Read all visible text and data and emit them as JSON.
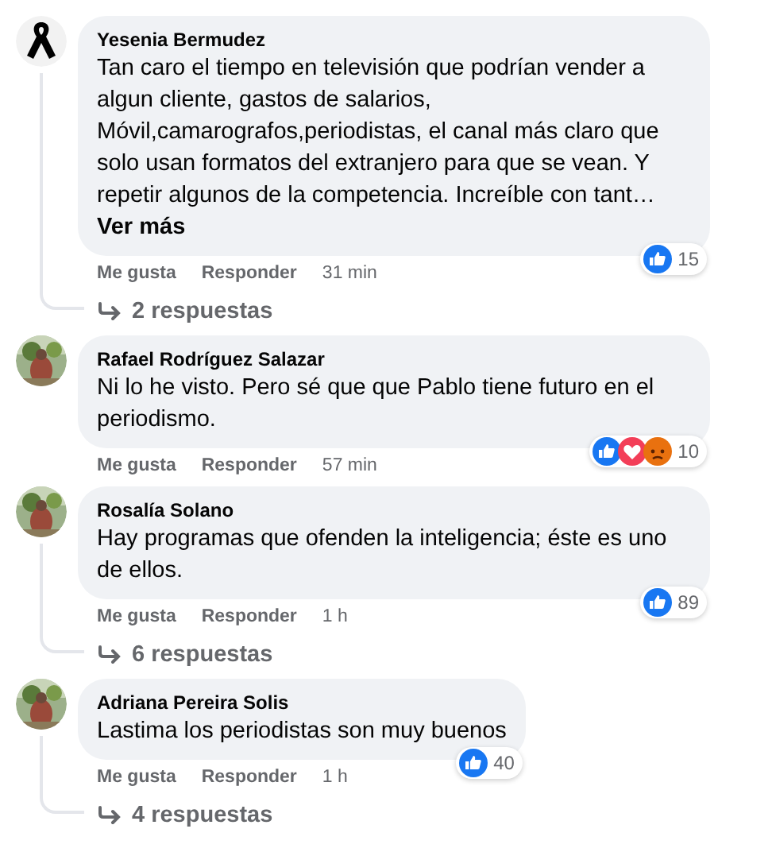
{
  "comments": [
    {
      "avatar": {
        "kind": "ribbon"
      },
      "author": "Yesenia Bermudez",
      "text": "Tan caro el tiempo en televisión que podrían vender a algun cliente, gastos de salarios, Móvil,camarografos,periodistas, el canal más claro que solo usan formatos del extranjero para que se vean. Y repetir algunos de la competencia. Increíble con tant…",
      "more": "Ver más",
      "reactions": [
        {
          "kind": "like"
        }
      ],
      "reaction_count": "15",
      "like": "Me gusta",
      "reply": "Responder",
      "time": "31 min",
      "replies": "2 respuestas"
    },
    {
      "avatar": {
        "kind": "picture"
      },
      "author": "Rafael Rodríguez Salazar",
      "text": "Ni lo he visto. Pero sé que que Pablo tiene futuro en el periodismo.",
      "reactions": [
        {
          "kind": "like"
        },
        {
          "kind": "love"
        },
        {
          "kind": "angry"
        }
      ],
      "reaction_count": "10",
      "like": "Me gusta",
      "reply": "Responder",
      "time": "57 min"
    },
    {
      "avatar": {
        "kind": "picture"
      },
      "author": "Rosalía Solano",
      "text": "Hay programas que ofenden la inteligencia; éste es uno de ellos.",
      "reactions": [
        {
          "kind": "like"
        }
      ],
      "reaction_count": "89",
      "like": "Me gusta",
      "reply": "Responder",
      "time": "1 h",
      "replies": "6 respuestas"
    },
    {
      "avatar": {
        "kind": "picture"
      },
      "author": "Adriana Pereira Solis",
      "text": "Lastima los periodistas son muy buenos",
      "reactions": [
        {
          "kind": "like"
        }
      ],
      "reaction_count": "40",
      "like": "Me gusta",
      "reply": "Responder",
      "time": "1 h",
      "replies": "4 respuestas"
    }
  ]
}
